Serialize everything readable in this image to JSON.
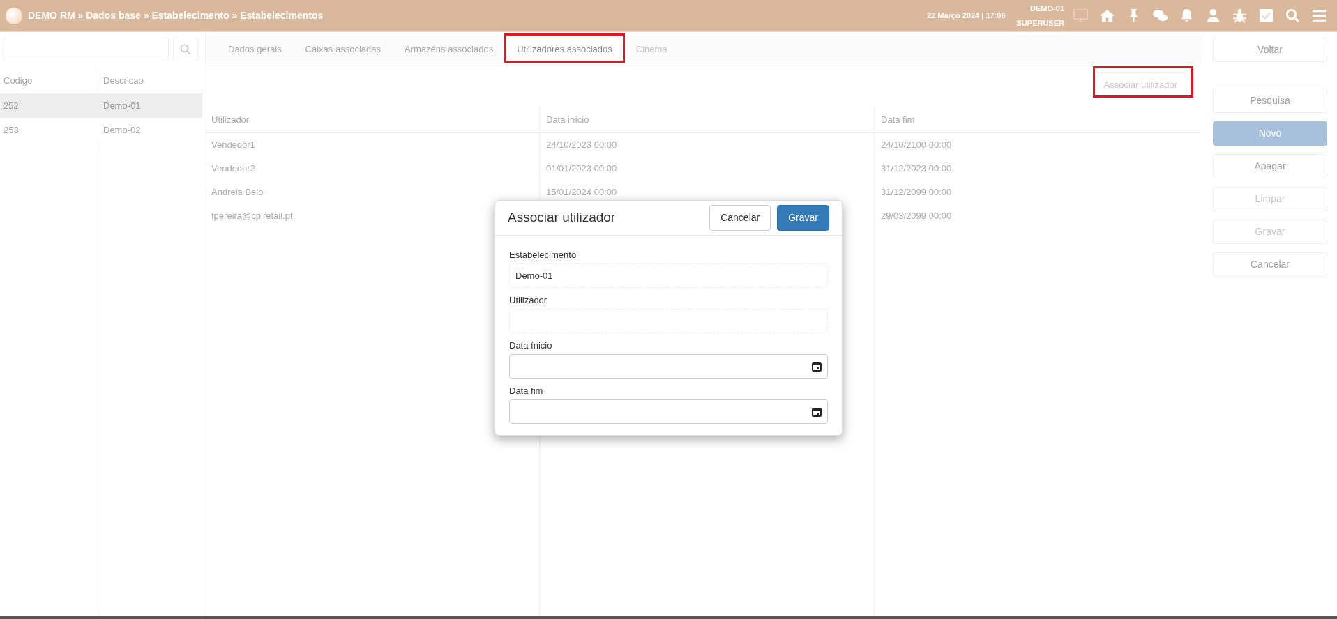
{
  "header": {
    "breadcrumb": "DEMO RM » Dados base » Estabelecimento » Estabelecimentos",
    "datetime": "22 Março 2024 | 17:06",
    "store": "DEMO-01",
    "user": "SUPERUSER"
  },
  "list": {
    "columns": [
      "Codigo",
      "Descricao"
    ],
    "rows": [
      {
        "cells": [
          "252",
          "Demo-01"
        ],
        "selected": true
      },
      {
        "cells": [
          "253",
          "Demo-02"
        ],
        "selected": false
      }
    ]
  },
  "tabs": [
    {
      "label": "Dados gerais",
      "selected": false,
      "disabled": false,
      "highlighted": false
    },
    {
      "label": "Caixas associadas",
      "selected": false,
      "disabled": false,
      "highlighted": false
    },
    {
      "label": "Armazéns associados",
      "selected": false,
      "disabled": false,
      "highlighted": false
    },
    {
      "label": "Utilizadores associados",
      "selected": true,
      "disabled": false,
      "highlighted": true
    },
    {
      "label": "Cinema",
      "selected": false,
      "disabled": true,
      "highlighted": false
    }
  ],
  "associate_button": {
    "label": "Associar utilizador",
    "highlighted": true
  },
  "table": {
    "columns": [
      "Utilizador",
      "Data início",
      "Data fim"
    ],
    "rows": [
      [
        "Vendedor1",
        "24/10/2023 00:00",
        "24/10/2100 00:00"
      ],
      [
        "Vendedor2",
        "01/01/2023 00:00",
        "31/12/2023 00:00"
      ],
      [
        "Andreia Belo",
        "15/01/2024 00:00",
        "31/12/2099 00:00"
      ],
      [
        "fpereira@cpiretail.pt",
        null,
        "29/03/2099 00:00"
      ]
    ]
  },
  "actions": [
    {
      "label": "Voltar",
      "kind": "plain",
      "disabled": false
    },
    {
      "label": "Pesquisa",
      "kind": "plain",
      "disabled": false
    },
    {
      "label": "Novo",
      "kind": "primary",
      "disabled": false
    },
    {
      "label": "Apagar",
      "kind": "plain",
      "disabled": false
    },
    {
      "label": "Limpar",
      "kind": "plain",
      "disabled": true
    },
    {
      "label": "Gravar",
      "kind": "plain",
      "disabled": true
    },
    {
      "label": "Cancelar",
      "kind": "plain",
      "disabled": false
    }
  ],
  "dialog": {
    "title": "Associar utilizador",
    "buttons": [
      {
        "label": "Cancelar",
        "kind": "secondary"
      },
      {
        "label": "Gravar",
        "kind": "primary"
      }
    ],
    "fields": [
      {
        "label": "Estabelecimento",
        "kind": "text",
        "readonly": true,
        "value": "Demo-01"
      },
      {
        "label": "Utilizador",
        "kind": "text",
        "readonly": true
      },
      {
        "label": "Data ínicio",
        "kind": "date",
        "readonly": false
      },
      {
        "label": "Data fim",
        "kind": "date",
        "readonly": false
      }
    ]
  }
}
